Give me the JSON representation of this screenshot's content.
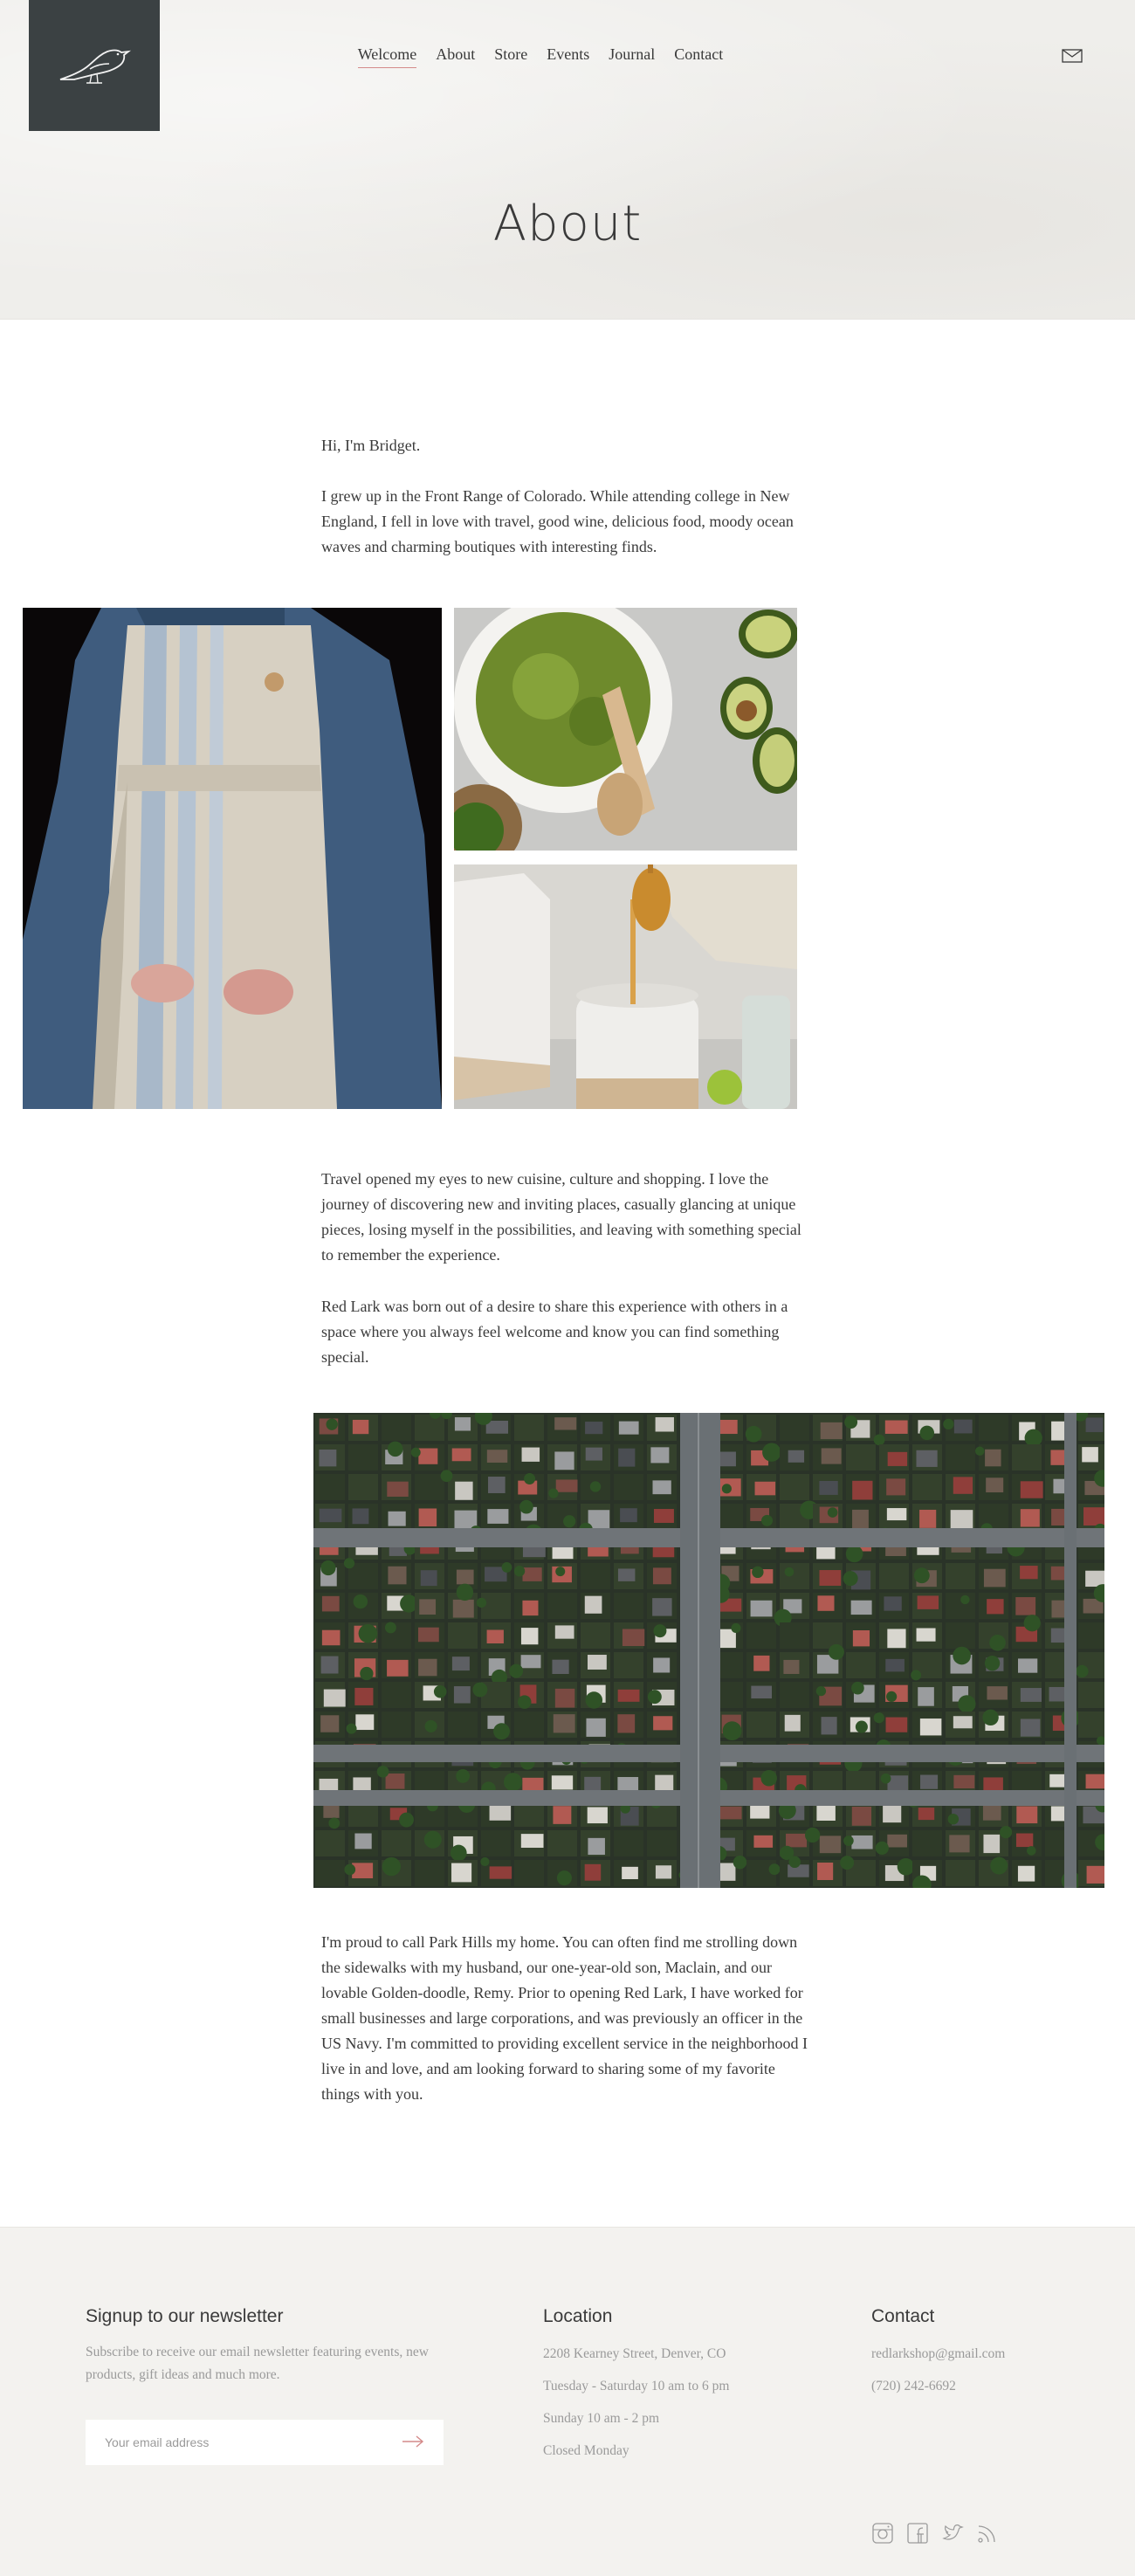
{
  "brand": {
    "logo_icon": "bird-logo-icon",
    "color": "#3b4143"
  },
  "nav": {
    "items": [
      {
        "label": "Welcome",
        "active": true
      },
      {
        "label": "About"
      },
      {
        "label": "Store"
      },
      {
        "label": "Events"
      },
      {
        "label": "Journal"
      },
      {
        "label": "Contact"
      }
    ],
    "mail_icon": "envelope-icon"
  },
  "page": {
    "title": "About"
  },
  "content": {
    "intro_greeting": "Hi, I'm Bridget.",
    "intro_text": "I grew up in the Front Range of Colorado. While attending college in New England, I fell in love with travel, good wine, delicious food, moody ocean waves and charming boutiques with interesting finds.",
    "travel_text": "Travel opened my eyes to new cuisine, culture and shopping. I love the journey of discovering new and inviting places, casually glancing at unique pieces, losing myself in the possibilities, and leaving with something special to remember the experience.",
    "redlark_text": "Red Lark was born out of a desire to share this experience with others in a space where you always feel welcome and know you can find something special.",
    "home_text": "I'm proud to call Park Hills my home. You can often find me strolling down the sidewalks with my husband, our one-year-old son, Maclain, and our lovable Golden-doodle, Remy. Prior to opening Red Lark, I have worked for small businesses and large corporations, and was previously an officer in the US Navy. I'm committed to providing excellent service in the neighborhood I live in and love, and am looking forward to sharing some of my favorite things with you."
  },
  "footer": {
    "newsletter": {
      "heading": "Signup to our newsletter",
      "text": "Subscribe to receive our email newsletter featuring events, new products, gift ideas and much more.",
      "placeholder": "Your email address",
      "submit_icon": "arrow-right-icon"
    },
    "location": {
      "heading": "Location",
      "address": "2208 Kearney Street, Denver, CO",
      "hours_1": "Tuesday - Saturday 10 am to 6 pm",
      "hours_2": "Sunday 10 am - 2 pm",
      "hours_3": "Closed Monday"
    },
    "contact": {
      "heading": "Contact",
      "email": "redlarkshop@gmail.com",
      "phone": "(720) 242-6692",
      "social_icons": [
        "instagram-icon",
        "facebook-icon",
        "twitter-icon",
        "rss-icon"
      ]
    }
  },
  "colors": {
    "accent": "#d48a8a",
    "background": "#efeeeb",
    "footer_bg": "#f3f2ef",
    "text": "#3a3a3a",
    "muted": "#9a9a9a"
  }
}
